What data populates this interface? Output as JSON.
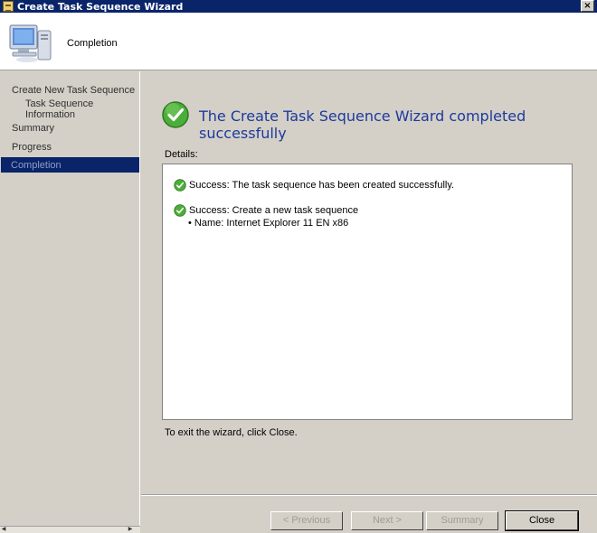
{
  "window": {
    "title": "Create Task Sequence Wizard",
    "close_glyph": "×"
  },
  "header": {
    "title": "Completion"
  },
  "sidebar": {
    "items": [
      {
        "label": "Create New Task Sequence"
      },
      {
        "label": "Task Sequence Information"
      },
      {
        "label": "Summary"
      },
      {
        "label": "Progress"
      },
      {
        "label": "Completion"
      }
    ],
    "active": "Completion"
  },
  "main": {
    "result_title": "The Create Task Sequence Wizard completed successfully",
    "details_label": "Details:",
    "details": [
      {
        "text": "Success: The task sequence has been created successfully."
      },
      {
        "text": "Success: Create a new task sequence",
        "bullet": "• Name: Internet Explorer 11 EN x86"
      }
    ],
    "exit_text": "To exit the wizard, click Close."
  },
  "buttons": {
    "previous": "< Previous",
    "next": "Next >",
    "summary": "Summary",
    "close": "Close"
  },
  "colors": {
    "titlebar": "#0a246a",
    "accent_text": "#1c3a9c",
    "success": "#3a9a2a"
  }
}
